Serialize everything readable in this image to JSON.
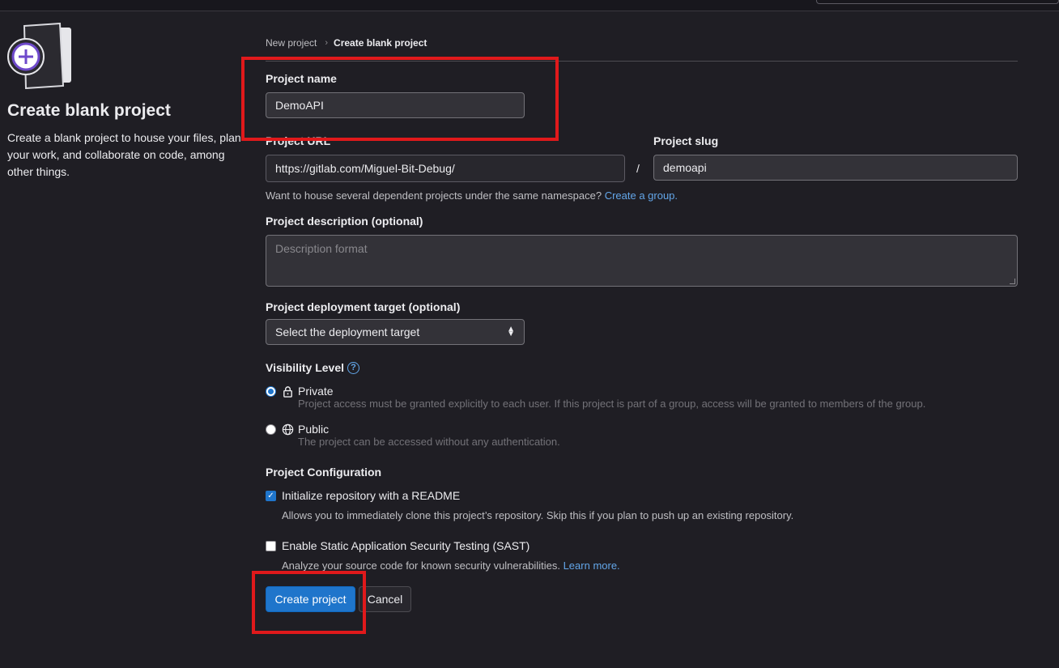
{
  "breadcrumb": {
    "parent": "New project",
    "current": "Create blank project"
  },
  "left_panel": {
    "title": "Create blank project",
    "description": "Create a blank project to house your files, plan your work, and collaborate on code, among other things."
  },
  "form": {
    "project_name": {
      "label": "Project name",
      "value": "DemoAPI"
    },
    "project_url": {
      "label": "Project URL",
      "value": "https://gitlab.com/Miguel-Bit-Debug/"
    },
    "url_separator": "/",
    "project_slug": {
      "label": "Project slug",
      "value": "demoapi"
    },
    "group_hint": {
      "text": "Want to house several dependent projects under the same namespace?",
      "link": "Create a group."
    },
    "description": {
      "label": "Project description (optional)",
      "placeholder": "Description format"
    },
    "deployment": {
      "label": "Project deployment target (optional)",
      "selected": "Select the deployment target"
    },
    "visibility": {
      "label": "Visibility Level",
      "help_icon": "question-circle-icon",
      "options": [
        {
          "label": "Private",
          "icon": "lock-icon",
          "help": "Project access must be granted explicitly to each user. If this project is part of a group, access will be granted to members of the group.",
          "checked": true
        },
        {
          "label": "Public",
          "icon": "globe-icon",
          "help": "The project can be accessed without any authentication.",
          "checked": false
        }
      ]
    },
    "configuration": {
      "label": "Project Configuration",
      "readme": {
        "label": "Initialize repository with a README",
        "help": "Allows you to immediately clone this project’s repository. Skip this if you plan to push up an existing repository.",
        "checked": true
      },
      "sast": {
        "label": "Enable Static Application Security Testing (SAST)",
        "help": "Analyze your source code for known security vulnerabilities.",
        "link": "Learn more.",
        "checked": false
      }
    }
  },
  "actions": {
    "create": "Create project",
    "cancel": "Cancel"
  },
  "colors": {
    "background": "#1f1e24",
    "primary": "#1f75cb",
    "link": "#63a6e9",
    "highlight": "#e0191b"
  }
}
